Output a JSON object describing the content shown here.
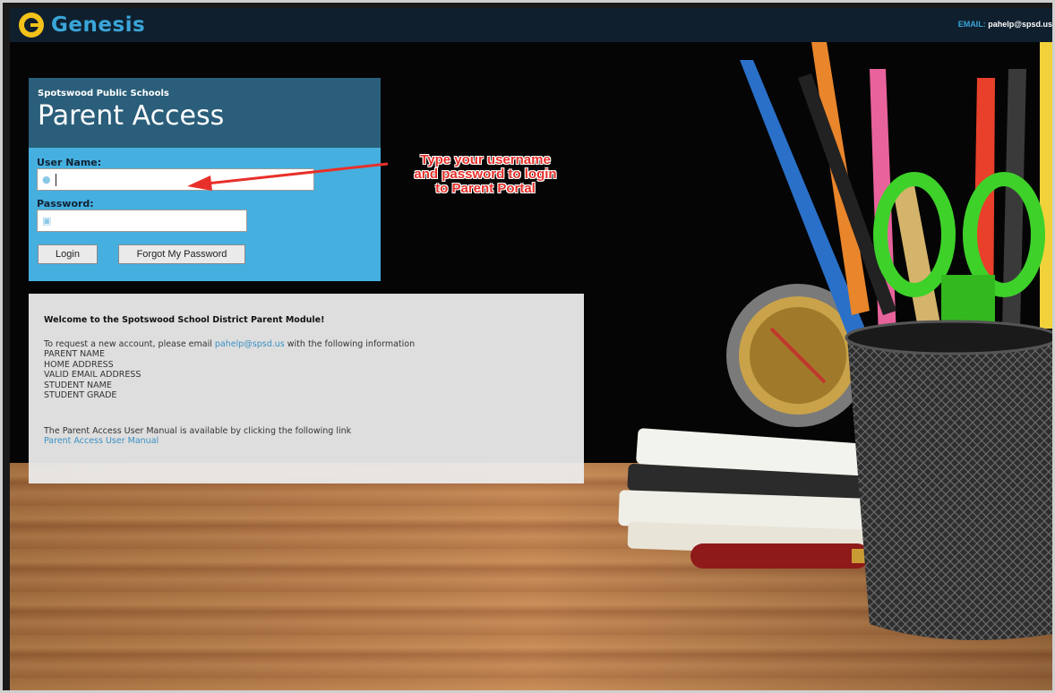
{
  "topbar": {
    "brand": "Genesis",
    "email_label": "EMAIL:",
    "email_value": "pahelp@spsd.us"
  },
  "login": {
    "school": "Spotswood Public Schools",
    "title": "Parent Access",
    "username_label": "User Name:",
    "username_value": "",
    "password_label": "Password:",
    "password_value": "",
    "login_button": "Login",
    "forgot_button": "Forgot My Password"
  },
  "annotation": {
    "line1": "Type your username",
    "line2": "and password to login",
    "line3": "to Parent Portal"
  },
  "welcome": {
    "heading": "Welcome to the Spotswood School District Parent Module!",
    "request_prefix": "To request a new account, please email ",
    "request_email": "pahelp@spsd.us",
    "request_suffix": " with the following information",
    "fields": [
      "PARENT NAME",
      "HOME ADDRESS",
      "VALID EMAIL ADDRESS",
      "STUDENT NAME",
      "STUDENT GRADE"
    ],
    "manual_text": "The Parent Access User Manual is available by clicking the following link",
    "manual_link": "Parent Access User Manual"
  },
  "colors": {
    "topbar": "#0f1f2e",
    "brand": "#3aa5d8",
    "login_head": "#2a5e7a",
    "login_body": "#45b0e0",
    "annotation": "#e8302a"
  }
}
